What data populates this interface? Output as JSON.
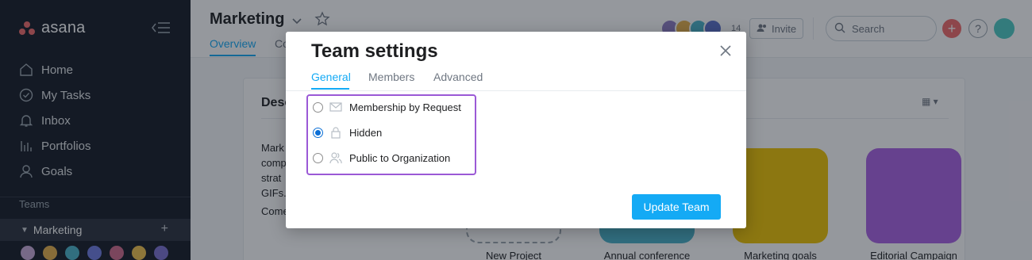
{
  "sidebar": {
    "logo_text": "asana",
    "nav": [
      {
        "label": "Home",
        "icon": "home-icon"
      },
      {
        "label": "My Tasks",
        "icon": "check-circle-icon"
      },
      {
        "label": "Inbox",
        "icon": "bell-icon"
      },
      {
        "label": "Portfolios",
        "icon": "bar-chart-icon"
      },
      {
        "label": "Goals",
        "icon": "person-icon"
      }
    ],
    "teams_label": "Teams",
    "team": {
      "name": "Marketing"
    }
  },
  "header": {
    "title": "Marketing",
    "tabs": [
      {
        "label": "Overview"
      },
      {
        "label": "Co"
      }
    ],
    "member_count": "14",
    "invite_label": "Invite",
    "search_placeholder": "Search"
  },
  "content": {
    "description_heading": "Desc",
    "description_lines": [
      "Mark",
      "comp",
      "strat",
      "GIFs.",
      "Come"
    ],
    "projects": [
      {
        "label": "New Project"
      },
      {
        "label": "Annual conference"
      },
      {
        "label": "Marketing goals"
      },
      {
        "label": "Editorial Campaign"
      }
    ]
  },
  "modal": {
    "title": "Team settings",
    "tabs": [
      {
        "label": "General",
        "active": true
      },
      {
        "label": "Members",
        "active": false
      },
      {
        "label": "Advanced",
        "active": false
      }
    ],
    "options": [
      {
        "label": "Membership by Request",
        "icon": "envelope-icon",
        "checked": false
      },
      {
        "label": "Hidden",
        "icon": "lock-icon",
        "checked": true
      },
      {
        "label": "Public to Organization",
        "icon": "people-icon",
        "checked": false
      }
    ],
    "submit_label": "Update Team"
  },
  "colors": {
    "accent": "#14aaf5",
    "sidebar_bg": "#151b26",
    "highlight_border": "#9b59d6",
    "brand_coral": "#f06a6a"
  }
}
